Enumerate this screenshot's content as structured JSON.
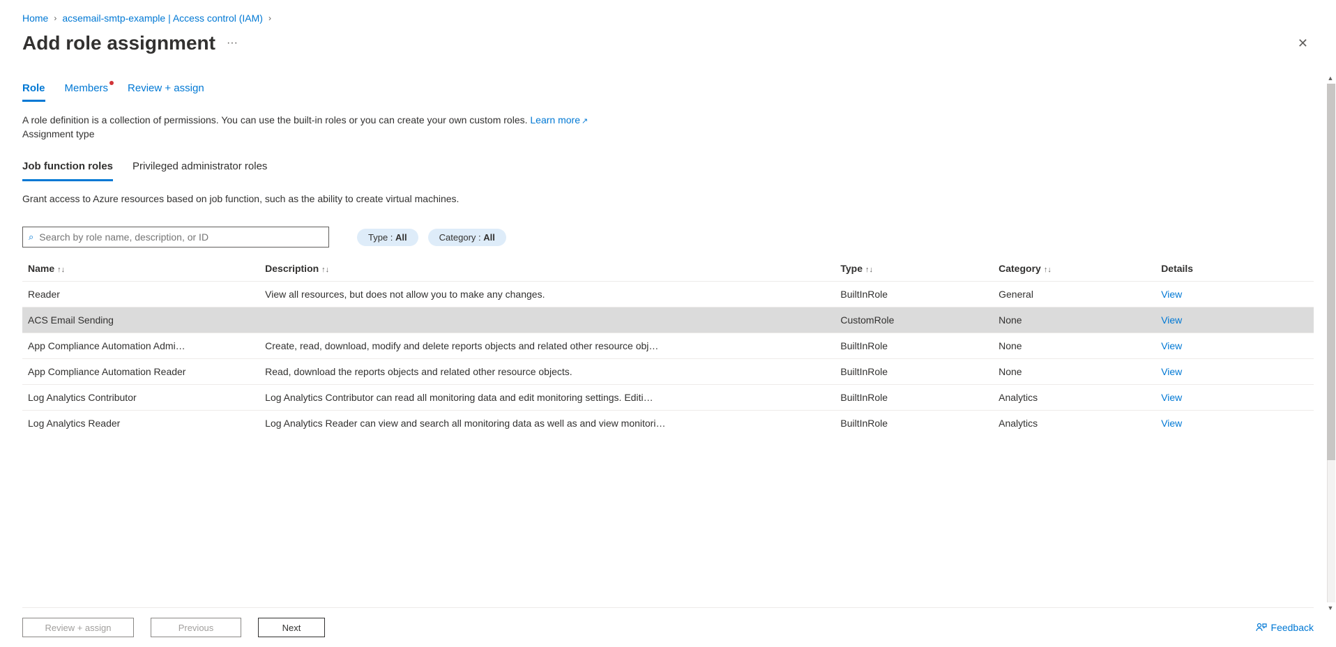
{
  "breadcrumb": {
    "home": "Home",
    "resource": "acsemail-smtp-example | Access control (IAM)"
  },
  "title": "Add role assignment",
  "mainTabs": {
    "role": "Role",
    "members": "Members",
    "review": "Review + assign"
  },
  "descriptionText": "A role definition is a collection of permissions. You can use the built-in roles or you can create your own custom roles. ",
  "learnMore": "Learn more",
  "assignmentType": "Assignment type",
  "subTabs": {
    "job": "Job function roles",
    "priv": "Privileged administrator roles"
  },
  "subDescription": "Grant access to Azure resources based on job function, such as the ability to create virtual machines.",
  "search": {
    "placeholder": "Search by role name, description, or ID"
  },
  "filters": {
    "typeLabel": "Type : ",
    "typeValue": "All",
    "categoryLabel": "Category : ",
    "categoryValue": "All"
  },
  "columns": {
    "name": "Name",
    "description": "Description",
    "type": "Type",
    "category": "Category",
    "details": "Details"
  },
  "rows": [
    {
      "name": "Reader",
      "description": "View all resources, but does not allow you to make any changes.",
      "type": "BuiltInRole",
      "category": "General",
      "details": "View",
      "selected": false
    },
    {
      "name": "ACS Email Sending",
      "description": "",
      "type": "CustomRole",
      "category": "None",
      "details": "View",
      "selected": true
    },
    {
      "name": "App Compliance Automation Admi…",
      "description": "Create, read, download, modify and delete reports objects and related other resource obj…",
      "type": "BuiltInRole",
      "category": "None",
      "details": "View",
      "selected": false
    },
    {
      "name": "App Compliance Automation Reader",
      "description": "Read, download the reports objects and related other resource objects.",
      "type": "BuiltInRole",
      "category": "None",
      "details": "View",
      "selected": false
    },
    {
      "name": "Log Analytics Contributor",
      "description": "Log Analytics Contributor can read all monitoring data and edit monitoring settings. Editi…",
      "type": "BuiltInRole",
      "category": "Analytics",
      "details": "View",
      "selected": false
    },
    {
      "name": "Log Analytics Reader",
      "description": "Log Analytics Reader can view and search all monitoring data as well as and view monitori…",
      "type": "BuiltInRole",
      "category": "Analytics",
      "details": "View",
      "selected": false,
      "cutoff": true
    }
  ],
  "footer": {
    "reviewAssign": "Review + assign",
    "previous": "Previous",
    "next": "Next",
    "feedback": "Feedback"
  }
}
